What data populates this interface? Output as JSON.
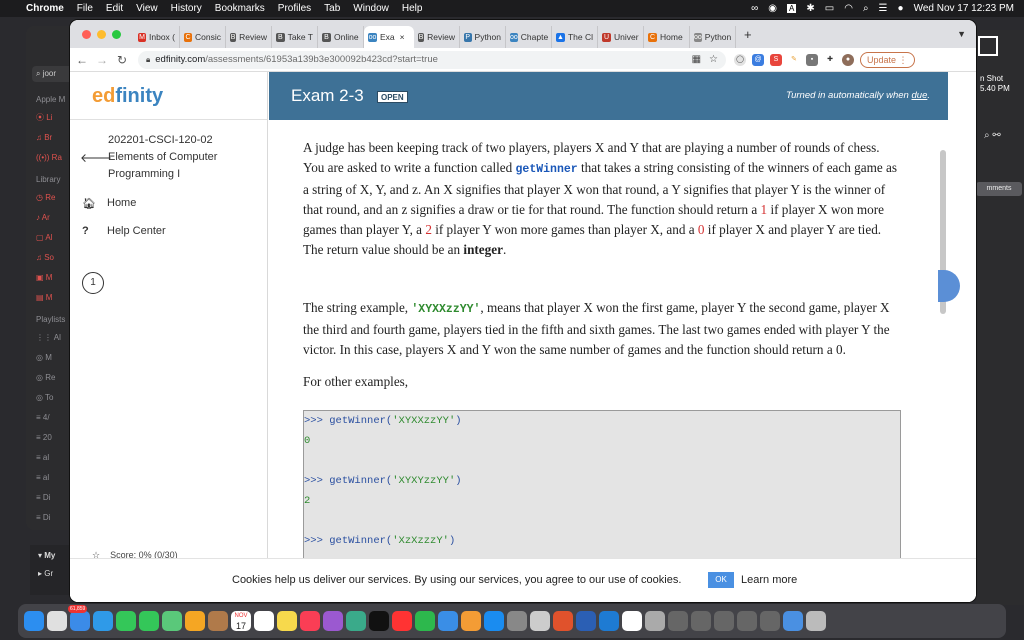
{
  "menubar": {
    "app": "Chrome",
    "items": [
      "File",
      "Edit",
      "View",
      "History",
      "Bookmarks",
      "Profiles",
      "Tab",
      "Window",
      "Help"
    ],
    "clock": "Wed Nov 17  12:23 PM"
  },
  "bg_app": {
    "search": "joor",
    "header_apple": "Apple M",
    "header_library": "Library",
    "header_playlists": "Playlists",
    "bottom_my": "My",
    "bottom_gr": "Gr"
  },
  "bg_right": {
    "shot_line1": "n Shot",
    "shot_line2": "5.40 PM",
    "comments": "mments"
  },
  "tabs": [
    {
      "label": "Inbox (",
      "fav": "M",
      "color": "#d93025"
    },
    {
      "label": "Consic",
      "fav": "C",
      "color": "#e8710a"
    },
    {
      "label": "Review",
      "fav": "B",
      "color": "#555"
    },
    {
      "label": "Take T",
      "fav": "B",
      "color": "#555"
    },
    {
      "label": "Online",
      "fav": "B",
      "color": "#555"
    },
    {
      "label": "Exa",
      "fav": "oo",
      "color": "#3b84c0"
    },
    {
      "label": "Review",
      "fav": "B",
      "color": "#555"
    },
    {
      "label": "Python",
      "fav": "P",
      "color": "#3776ab"
    },
    {
      "label": "Chapte",
      "fav": "oo",
      "color": "#3b84c0"
    },
    {
      "label": "The Cl",
      "fav": "▲",
      "color": "#1a73e8"
    },
    {
      "label": "Univer",
      "fav": "U",
      "color": "#c0392b"
    },
    {
      "label": "Home",
      "fav": "C",
      "color": "#e8710a"
    },
    {
      "label": "Python",
      "fav": "oo",
      "color": "#888"
    }
  ],
  "address": {
    "host": "edfinity.com",
    "path": "/assessments/61953a139b3e300092b423cd?start=true"
  },
  "update_label": "Update",
  "brand": {
    "ed": "ed",
    "finity": "finity"
  },
  "course": {
    "code": "202201-CSCI-120-02",
    "name_line1": "Elements of Computer",
    "name_line2": "Programming I"
  },
  "nav": {
    "home": "Home",
    "help": "Help Center"
  },
  "question_number": "1",
  "score": "Score: 0% (0/30)",
  "exam": {
    "title": "Exam 2-3",
    "badge": "OPEN",
    "due_text": "Turned in automatically when",
    "due_link": "due",
    "due_end": "."
  },
  "problem": {
    "p1_a": "A judge has been keeping track of two players, players X and Y that are playing a number of rounds of chess. You are asked to write a function called ",
    "fn_name": "getWinner",
    "p1_b": " that takes a string consisting of the winners of each game as a string of X, Y, and z. An X signifies that player X won that round, a Y signifies that player Y is the winner of that round, and an z signifies a draw or tie for that round. The function should return a ",
    "num1": "1",
    "p1_c": " if player X won more games than player Y, a ",
    "num2": "2",
    "p1_d": " if player Y won more games than player X, and a ",
    "num0": "0",
    "p1_e": " if player X and player Y are tied. The return value should be an ",
    "integer": "integer",
    "p1_f": ".",
    "p2_a": "The string example, ",
    "example_str": "'XYXXzzYY'",
    "p2_b": ", means that player X won the first game, player Y the second game, player X the third and fourth game, players tied in the fifth and sixth games. The last two games ended with player Y the victor. In this case, players X and Y won the same number of games and the function should return a 0.",
    "p3": "For other examples,"
  },
  "examples": [
    {
      "prompt": ">>> ",
      "call": "getWinner(",
      "arg": "'XYXXzzYY'",
      "close": ")",
      "result": "0"
    },
    {
      "prompt": ">>> ",
      "call": "getWinner(",
      "arg": "'XYXYzzYY'",
      "close": ")",
      "result": "2"
    },
    {
      "prompt": ">>> ",
      "call": "getWinner(",
      "arg": "'XzXzzzY'",
      "close": ")",
      "result": ""
    }
  ],
  "cookie": {
    "message": "Cookies help us deliver our services. By using our services, you agree to our use of cookies.",
    "ok": "OK",
    "learn_more": "Learn more"
  },
  "dock_badges": {
    "mail": "61,859",
    "cal_month": "NOV",
    "cal_day": "17"
  }
}
